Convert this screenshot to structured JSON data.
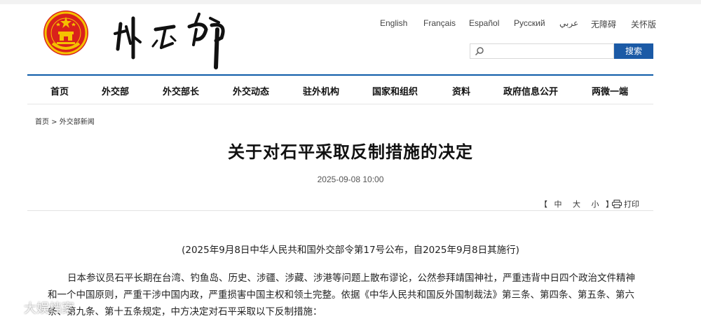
{
  "header": {
    "languages": [
      "English",
      "Français",
      "Español",
      "Русский",
      "عربي",
      "无障碍",
      "关怀版"
    ],
    "search": {
      "placeholder": "",
      "button_label": "搜索"
    }
  },
  "nav": {
    "items": [
      "首页",
      "外交部",
      "外交部长",
      "外交动态",
      "驻外机构",
      "国家和组织",
      "资料",
      "政府信息公开",
      "两微一端"
    ]
  },
  "breadcrumb": "首页 > 外交部新闻",
  "article": {
    "title": "关于对石平采取反制措施的决定",
    "date": "2025-09-08 10:00",
    "font_size": {
      "open": "【",
      "large": "中",
      "medium": "大",
      "small": "小",
      "close": "】"
    },
    "print_label": "打印",
    "subtitle": "(2025年9月8日中华人民共和国外交部令第17号公布，自2025年9月8日其施行)",
    "paragraph": "日本参议员石平长期在台湾、钓鱼岛、历史、涉疆、涉藏、涉港等问题上散布谬论，公然参拜靖国神社，严重违背中日四个政治文件精神和一个中国原则，严重干涉中国内政，严重损害中国主权和领土完整。依据《中华人民共和国反外国制裁法》第三条、第四条、第五条、第六条、第九条、第十五条规定，中方决定对石平采取以下反制措施："
  },
  "watermark": {
    "text": "大娱档案"
  },
  "colors": {
    "nav_rule": "#0d5ba8",
    "search_button": "#1b5aa6",
    "emblem_red": "#d9211c",
    "emblem_gold": "#f5c100"
  },
  "icons": {
    "emblem": "national-emblem-icon",
    "search": "search-icon",
    "print": "printer-icon",
    "watermark_logo": "weibo-icon"
  }
}
